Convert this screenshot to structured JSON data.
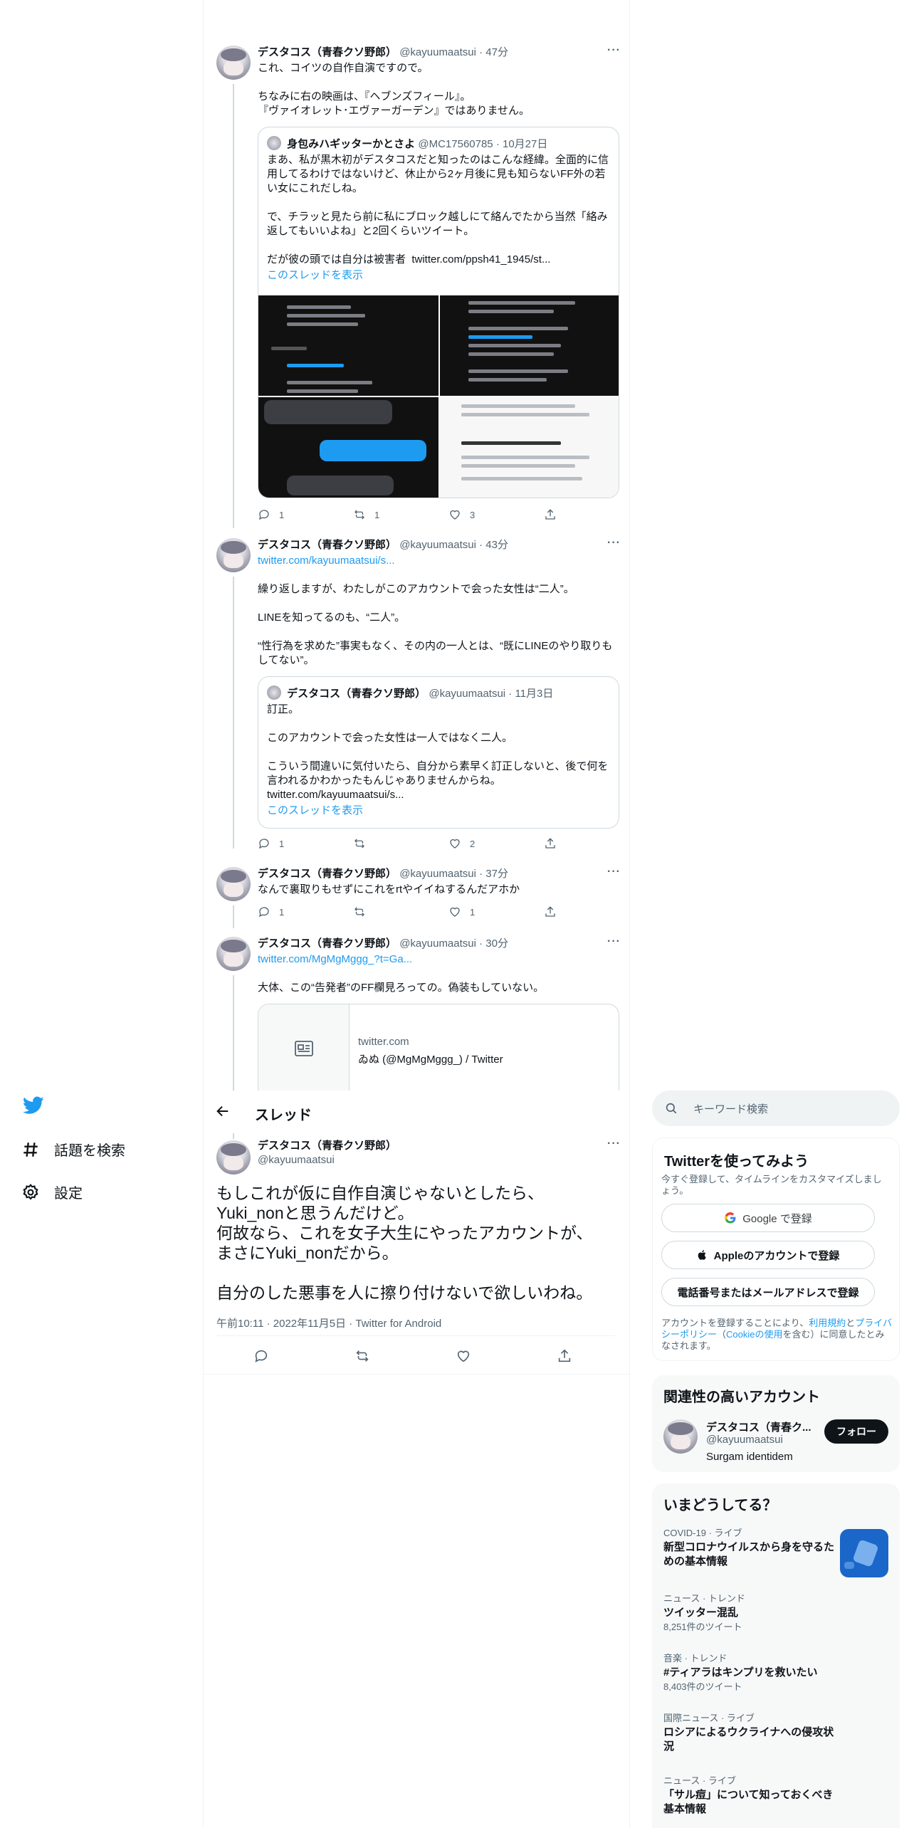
{
  "nav": {
    "explore": "話題を検索",
    "settings": "設定"
  },
  "thread_header": {
    "title": "スレッド"
  },
  "tweets": [
    {
      "name": "デスタコス（青春クソ野郎）",
      "handle": "@kayuumaatsui · 47分",
      "text": "これ、コイツの自作自演ですので。\n\nちなみに右の映画は、『ヘブンズフィール』。\n『ヴァイオレット･エヴァーガーデン』ではありません。",
      "quote": {
        "name": "身包みハギッターかとさよ",
        "handle": "@MC17560785 · 10月27日",
        "text": "まあ、私が黒木初がデスタコスだと知ったのはこんな経緯。全面的に信用してるわけではないけど、休止から2ヶ月後に見も知らないFF外の若い女にこれだしね。\n\nで、チラッと見たら前に私にブロック越しにて絡んでたから当然「絡み返してもいいよね」と2回くらいツイート。\n\nだが彼の頭では自分は被害者  twitter.com/ppsh41_1945/st...",
        "show_thread": "このスレッドを表示"
      },
      "replies": "1",
      "retweets": "1",
      "likes": "3"
    },
    {
      "name": "デスタコス（青春クソ野郎）",
      "handle": "@kayuumaatsui · 43分",
      "link": "twitter.com/kayuumaatsui/s...",
      "text": "繰り返しますが、わたしがこのアカウントで会った女性は“二人”。\n\nLINEを知ってるのも、“二人”。\n\n“性行為を求めた”事実もなく、その内の一人とは、“既にLINEのやり取りもしてない”。",
      "quote": {
        "name": "デスタコス（青春クソ野郎）",
        "handle": "@kayuumaatsui · 11月3日",
        "text": "訂正。\n\nこのアカウントで会った女性は一人ではなく二人。\n\nこういう間違いに気付いたら、自分から素早く訂正しないと、後で何を言われるかわかったもんじゃありませんからね。\ntwitter.com/kayuumaatsui/s...",
        "show_thread": "このスレッドを表示"
      },
      "replies": "1",
      "retweets": "",
      "likes": "2"
    },
    {
      "name": "デスタコス（青春クソ野郎）",
      "handle": "@kayuumaatsui · 37分",
      "text": "なんで裏取りもせずにこれをrtやイイねするんだアホか",
      "replies": "1",
      "retweets": "",
      "likes": "1"
    },
    {
      "name": "デスタコス（青春クソ野郎）",
      "handle": "@kayuumaatsui · 30分",
      "link": "twitter.com/MgMgMggg_?t=Ga...",
      "text": "大体、この“告発者”のFF欄見ろっての。偽装もしていない。",
      "card": {
        "domain": "twitter.com",
        "title": "ゐぬ (@MgMgMggg_) / Twitter"
      }
    }
  ],
  "main_tweet": {
    "name": "デスタコス（青春クソ野郎）",
    "handle": "@kayuumaatsui",
    "text": "もしこれが仮に自作自演じゃないとしたら、\nYuki_nonと思うんだけど。\n何故なら、これを女子大生にやったアカウントが、\nまさにYuki_nonだから。\n\n自分のした悪事を人に擦り付けないで欲しいわね。",
    "meta": "午前10:11 · 2022年11月5日 · Twitter for Android"
  },
  "sidebar": {
    "search_placeholder": "キーワード検索",
    "signup": {
      "title": "Twitterを使ってみよう",
      "subtitle": "今すぐ登録して、タイムラインをカスタマイズしましょう。",
      "google": "Google で登録",
      "apple": "Appleのアカウントで登録",
      "phone": "電話番号またはメールアドレスで登録",
      "terms_pre": "アカウントを登録することにより、",
      "terms_link1": "利用規約",
      "terms_mid": "と",
      "terms_link2": "プライバシーポリシー",
      "terms_paren": "（",
      "terms_link3": "Cookieの使用",
      "terms_post": "を含む）に同意したとみなされます。"
    },
    "related": {
      "title": "関連性の高いアカウント",
      "name": "デスタコス（青春ク...",
      "handle": "@kayuumaatsui",
      "bio": "Surgam identidem",
      "follow": "フォロー"
    },
    "trends": {
      "title": "いまどうしてる？",
      "items": [
        {
          "meta": "COVID-19 · ライブ",
          "title": "新型コロナウイルスから身を守るための基本情報",
          "count": ""
        },
        {
          "meta": "ニュース · トレンド",
          "title": "ツイッター混乱",
          "count": "8,251件のツイート"
        },
        {
          "meta": "音楽 · トレンド",
          "title": "#ティアラはキンプリを救いたい",
          "count": "8,403件のツイート"
        },
        {
          "meta": "国際ニュース · ライブ",
          "title": "ロシアによるウクライナへの侵攻状況",
          "count": ""
        },
        {
          "meta": "ニュース · ライブ",
          "title": "「サル痘」について知っておくべき基本情報",
          "count": ""
        }
      ]
    }
  }
}
